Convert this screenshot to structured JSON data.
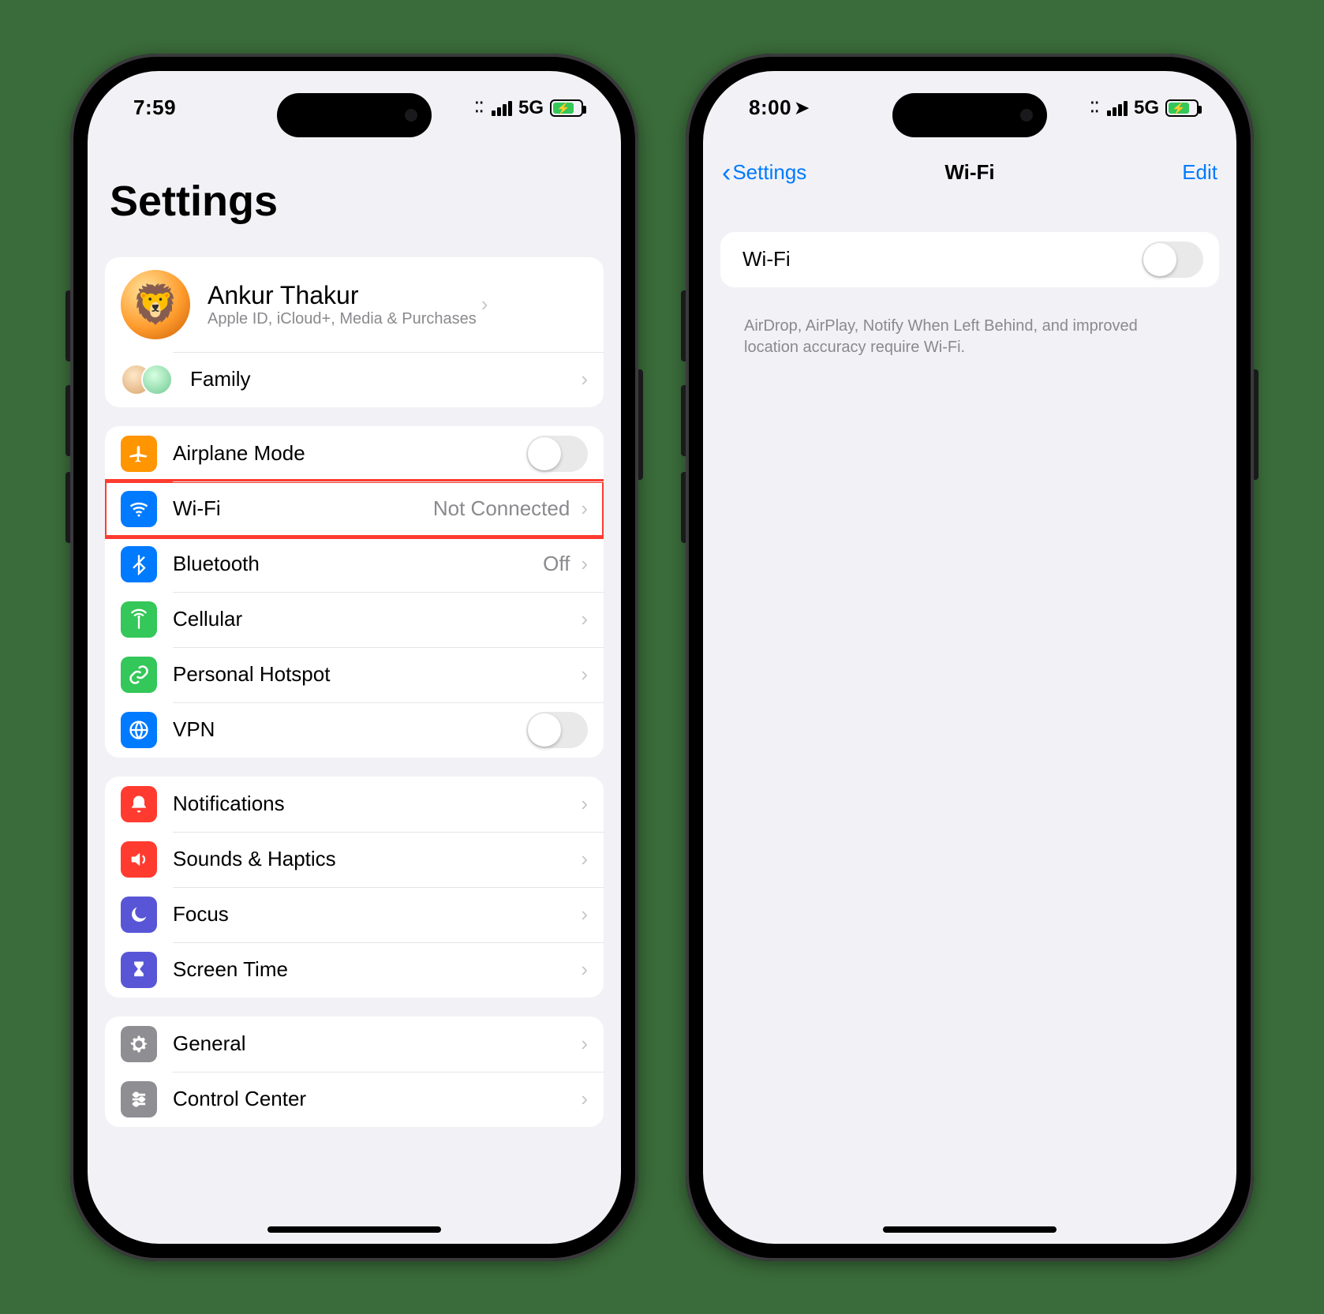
{
  "left": {
    "status": {
      "time": "7:59",
      "network": "5G"
    },
    "title": "Settings",
    "profile": {
      "name": "Ankur Thakur",
      "subtitle": "Apple ID, iCloud+, Media & Purchases"
    },
    "family": {
      "label": "Family"
    },
    "group_connectivity": [
      {
        "key": "airplane",
        "label": "Airplane Mode",
        "kind": "toggle",
        "icon": "airplane-icon",
        "icon_color": "ic-orange"
      },
      {
        "key": "wifi",
        "label": "Wi-Fi",
        "kind": "value",
        "value": "Not Connected",
        "icon": "wifi-icon",
        "icon_color": "ic-blue",
        "highlighted": true
      },
      {
        "key": "bluetooth",
        "label": "Bluetooth",
        "kind": "value",
        "value": "Off",
        "icon": "bluetooth-icon",
        "icon_color": "ic-blue"
      },
      {
        "key": "cellular",
        "label": "Cellular",
        "kind": "nav",
        "icon": "antenna-icon",
        "icon_color": "ic-green"
      },
      {
        "key": "hotspot",
        "label": "Personal Hotspot",
        "kind": "nav",
        "icon": "link-icon",
        "icon_color": "ic-green"
      },
      {
        "key": "vpn",
        "label": "VPN",
        "kind": "toggle",
        "icon": "globe-icon",
        "icon_color": "ic-blue"
      }
    ],
    "group_alerts": [
      {
        "key": "notifications",
        "label": "Notifications",
        "icon": "bell-icon",
        "icon_color": "ic-red"
      },
      {
        "key": "sounds",
        "label": "Sounds & Haptics",
        "icon": "speaker-icon",
        "icon_color": "ic-red"
      },
      {
        "key": "focus",
        "label": "Focus",
        "icon": "moon-icon",
        "icon_color": "ic-purple"
      },
      {
        "key": "screentime",
        "label": "Screen Time",
        "icon": "hourglass-icon",
        "icon_color": "ic-purple"
      }
    ],
    "group_general": [
      {
        "key": "general",
        "label": "General",
        "icon": "gear-icon",
        "icon_color": "ic-gray"
      },
      {
        "key": "control",
        "label": "Control Center",
        "icon": "sliders-icon",
        "icon_color": "ic-gray"
      }
    ]
  },
  "right": {
    "status": {
      "time": "8:00",
      "network": "5G",
      "location": true
    },
    "nav": {
      "back": "Settings",
      "title": "Wi-Fi",
      "edit": "Edit"
    },
    "wifi_toggle": {
      "label": "Wi-Fi",
      "on": false
    },
    "footer": "AirDrop, AirPlay, Notify When Left Behind, and improved location accuracy require Wi-Fi."
  }
}
